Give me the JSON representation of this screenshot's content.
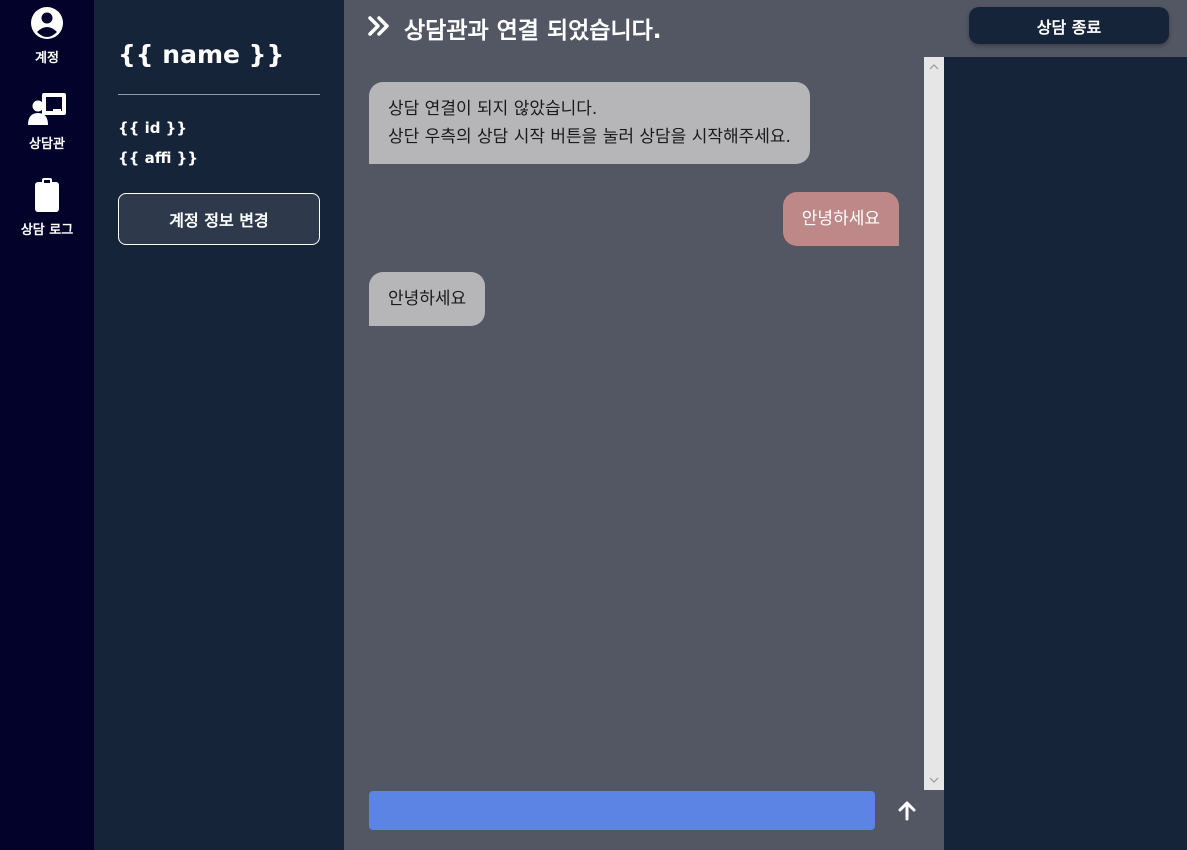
{
  "nav": {
    "items": [
      {
        "label": "계정",
        "icon": "account-icon"
      },
      {
        "label": "상담관",
        "icon": "counselor-icon"
      },
      {
        "label": "상담 로그",
        "icon": "clipboard-icon"
      }
    ]
  },
  "profile": {
    "name": "{{ name }}",
    "id": "{{ id }}",
    "affi": "{{ affi }}",
    "edit_button": "계정 정보 변경"
  },
  "header": {
    "title": "상담관과 연결 되었습니다.",
    "end_button": "상담 종료"
  },
  "messages": [
    {
      "type": "incoming",
      "lines": [
        "상담 연결이 되지 않았습니다.",
        "상단 우측의 상담 시작 버튼을 눌러 상담을 시작해주세요."
      ]
    },
    {
      "type": "outgoing",
      "lines": [
        "안녕하세요"
      ]
    },
    {
      "type": "incoming",
      "lines": [
        "안녕하세요"
      ]
    }
  ],
  "composer": {
    "value": "",
    "placeholder": ""
  },
  "colors": {
    "rail": "#03022a",
    "panel": "#16243a",
    "chat_bg": "#535764",
    "incoming_bubble": "#b6b6b8",
    "outgoing_bubble": "#bd8887",
    "composer": "#5b84e4"
  }
}
